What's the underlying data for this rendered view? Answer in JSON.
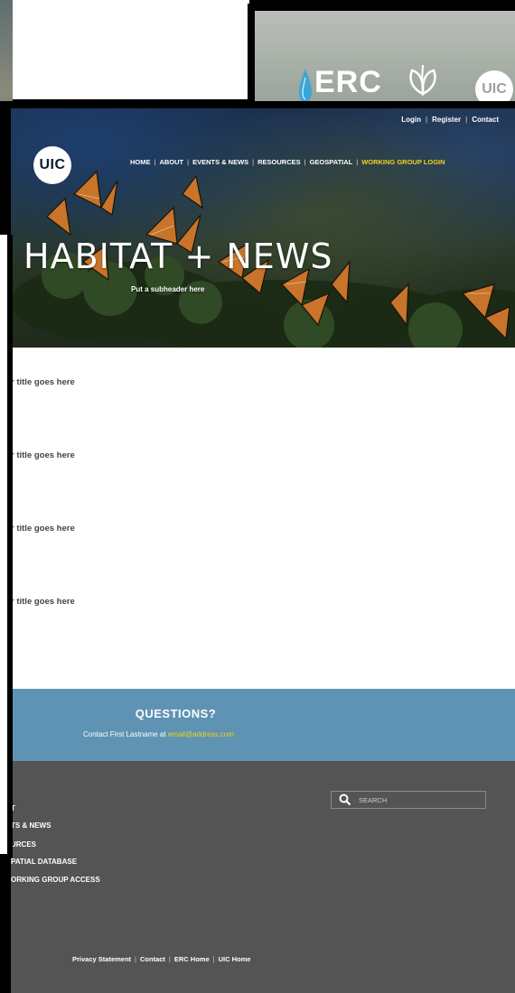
{
  "background_card": {
    "logo_text": "ERC",
    "logo_subtext": "",
    "uic_badge": "UIC"
  },
  "header": {
    "top_links": [
      "Login",
      "Register",
      "Contact"
    ],
    "logo": "UIC",
    "nav": [
      "HOME",
      "ABOUT",
      "EVENTS & NEWS",
      "RESOURCES",
      "GEOSPATIAL",
      "WORKING GROUP LOGIN"
    ]
  },
  "hero": {
    "title": "HABITAT + NEWS",
    "subtitle": "Put a subheader here"
  },
  "articles": [
    {
      "title": "r title goes here"
    },
    {
      "title": "r title goes here"
    },
    {
      "title": "r title goes here"
    },
    {
      "title": "r title goes here"
    }
  ],
  "questions": {
    "title": "QUESTIONS?",
    "contact_prefix": "Contact First Lastname at",
    "email": "email@address.com"
  },
  "footer": {
    "search_placeholder": "SEARCH",
    "links": [
      "T",
      "TS & NEWS",
      "URCES",
      "PATIAL DATABASE",
      "ORKING GROUP ACCESS"
    ],
    "legal": [
      "Privacy Statement",
      "Contact",
      "ERC Home",
      "UIC Home"
    ]
  },
  "colors": {
    "accent_yellow": "#f2d21a",
    "questions_bg": "#5f93b3",
    "footer_bg": "#545454"
  }
}
